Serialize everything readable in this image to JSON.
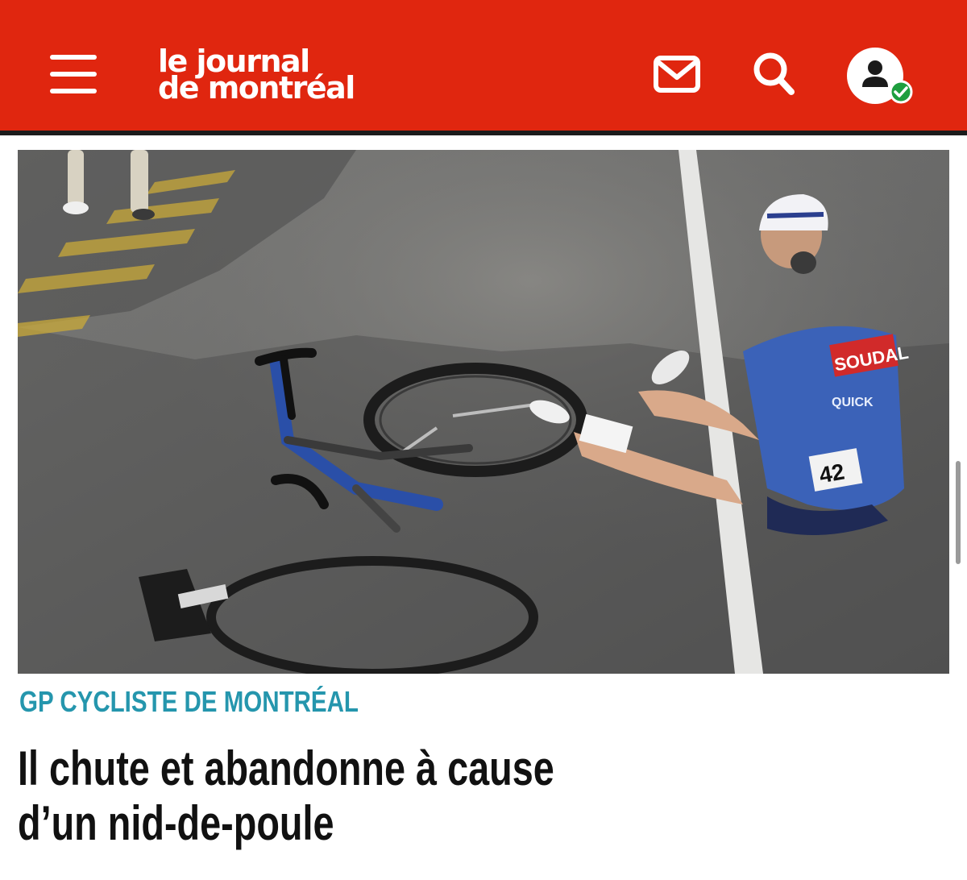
{
  "header": {
    "background_color": "#e0260f",
    "logo_line1": "le journal",
    "logo_line2": "de montréal",
    "menu_icon": "hamburger-menu-icon",
    "mail_icon": "envelope-icon",
    "search_icon": "magnifier-icon",
    "account_icon": "user-avatar-icon",
    "account_status_icon": "check-badge-icon",
    "account_status_color": "#1e9e3e"
  },
  "article": {
    "category": "GP CYCLISTE DE MONTRÉAL",
    "category_color": "#2596ad",
    "headline_line1": "Il chute et abandonne à cause",
    "headline_line2": "d’un nid-de-poule",
    "photo_rider_number": "42",
    "photo_jersey_text": "SOUDAL",
    "photo_jersey_text2": "QUICK"
  }
}
